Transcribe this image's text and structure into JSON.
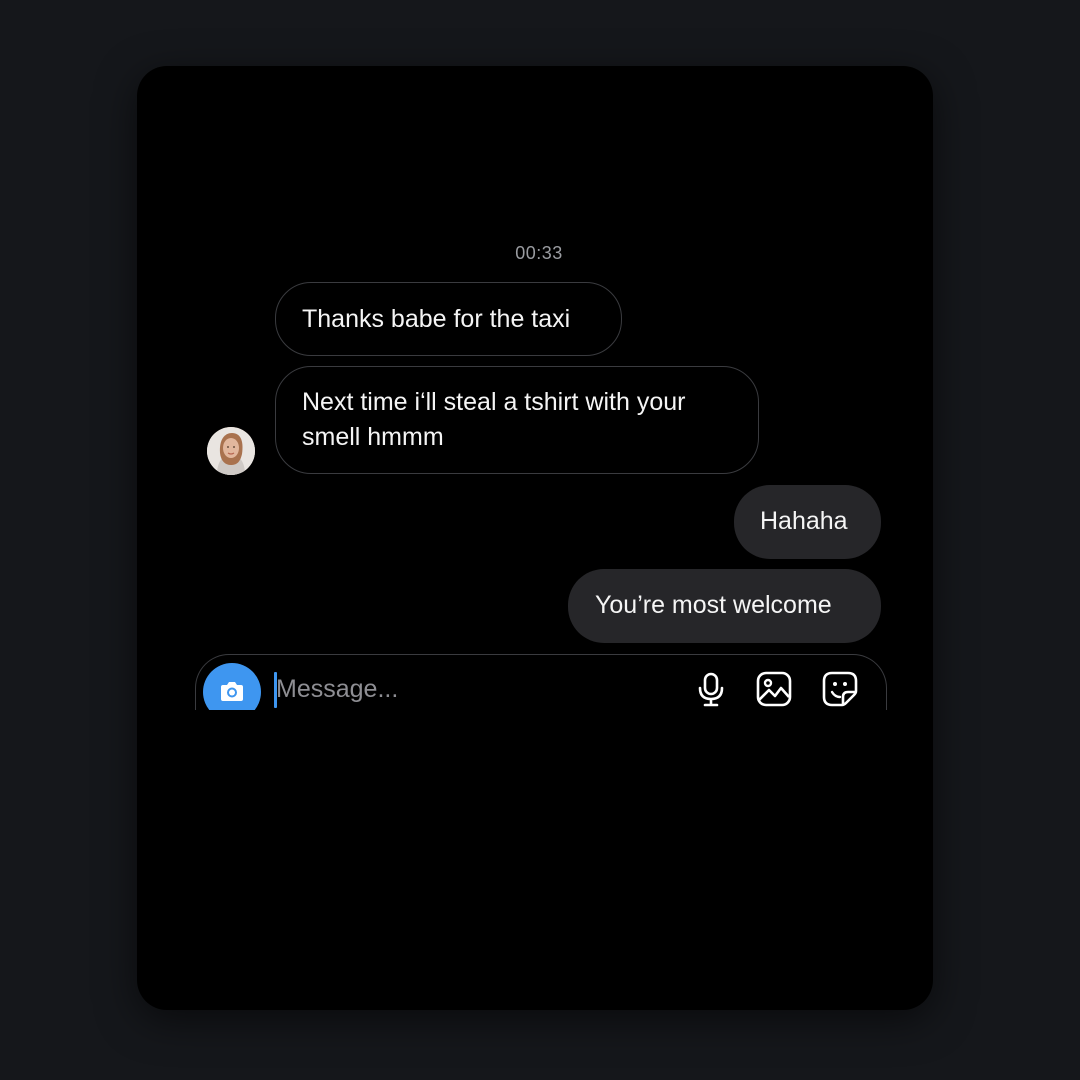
{
  "chat": {
    "timestamp": "00:33",
    "messages": [
      {
        "direction": "incoming",
        "text": "Thanks babe for the taxi"
      },
      {
        "direction": "incoming",
        "text": "Next time i‘ll steal a tshirt with your smell hmmm"
      },
      {
        "direction": "outgoing",
        "text": "Hahaha"
      },
      {
        "direction": "outgoing",
        "text": "You’re most welcome"
      }
    ]
  },
  "composer": {
    "placeholder": "Message...",
    "value": "",
    "icons": [
      "camera-icon",
      "microphone-icon",
      "gallery-icon",
      "sticker-icon"
    ]
  },
  "colors": {
    "accent": "#3e96f0",
    "outgoing_bubble": "#262629",
    "incoming_border": "#3a3b3f",
    "background": "#000000"
  }
}
